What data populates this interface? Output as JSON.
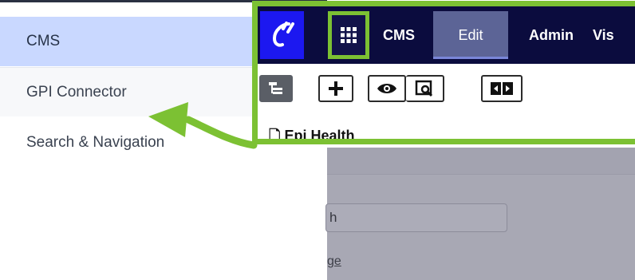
{
  "app_menu": {
    "items": [
      {
        "label": "CMS",
        "active": true
      },
      {
        "label": "GPI Connector",
        "active": false
      },
      {
        "label": "Search & Navigation",
        "active": false
      }
    ]
  },
  "cms_header": {
    "logo_icon": "optimizely-logo-icon",
    "apps_icon": "grid-icon",
    "nav": {
      "cms": "CMS",
      "edit": "Edit",
      "admin": "Admin",
      "visitor": "Vis"
    },
    "toolbar_icons": [
      "tree-icon",
      "plus-icon",
      "eye-icon",
      "preview-icon",
      "compare-icon"
    ],
    "page_title": "Epi Health"
  },
  "background_page": {
    "input_value": "h",
    "link_text": "ge"
  },
  "colors": {
    "highlight_green": "#7cc133",
    "navbar": "#0b0c3e",
    "logo_blue": "#1c18f0",
    "active_menu": "#c9d8ff"
  }
}
